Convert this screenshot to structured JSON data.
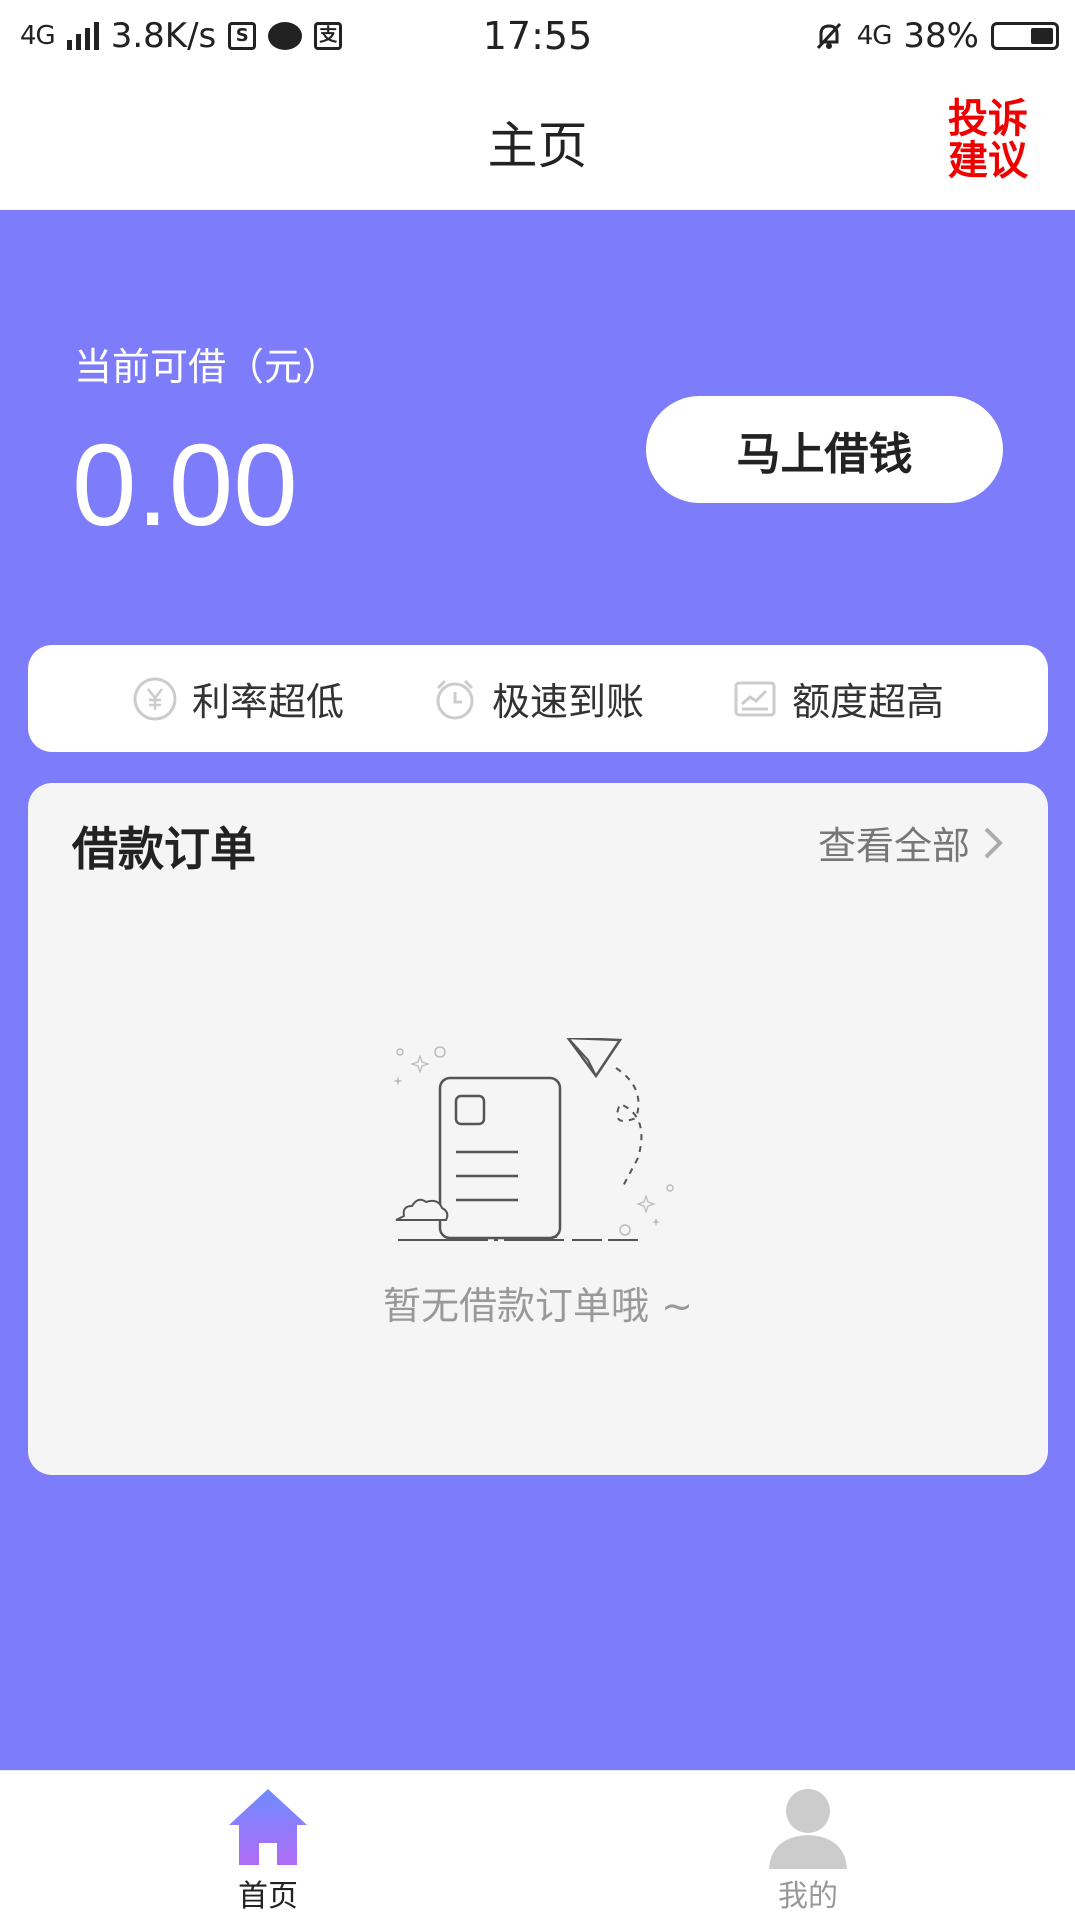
{
  "status_bar": {
    "network_left": "4G",
    "speed": "3.8K/s",
    "time": "17:55",
    "network_right": "4G",
    "battery": "38%"
  },
  "nav": {
    "title": "主页",
    "complaint_line1": "投诉",
    "complaint_line2": "建议"
  },
  "hero": {
    "label": "当前可借（元）",
    "amount": "0.00",
    "borrow_button": "马上借钱"
  },
  "features": [
    {
      "icon": "yen-coin-icon",
      "label": "利率超低"
    },
    {
      "icon": "alarm-clock-icon",
      "label": "极速到账"
    },
    {
      "icon": "chart-icon",
      "label": "额度超高"
    }
  ],
  "orders": {
    "title": "借款订单",
    "view_all": "查看全部",
    "empty_text": "暂无借款订单哦 ~"
  },
  "tabs": [
    {
      "label": "首页",
      "icon": "home-icon",
      "active": true
    },
    {
      "label": "我的",
      "icon": "user-icon",
      "active": false
    }
  ],
  "colors": {
    "primary": "#7d7cfb",
    "complaint": "#ee0000",
    "card_bg": "#f5f5f5"
  }
}
